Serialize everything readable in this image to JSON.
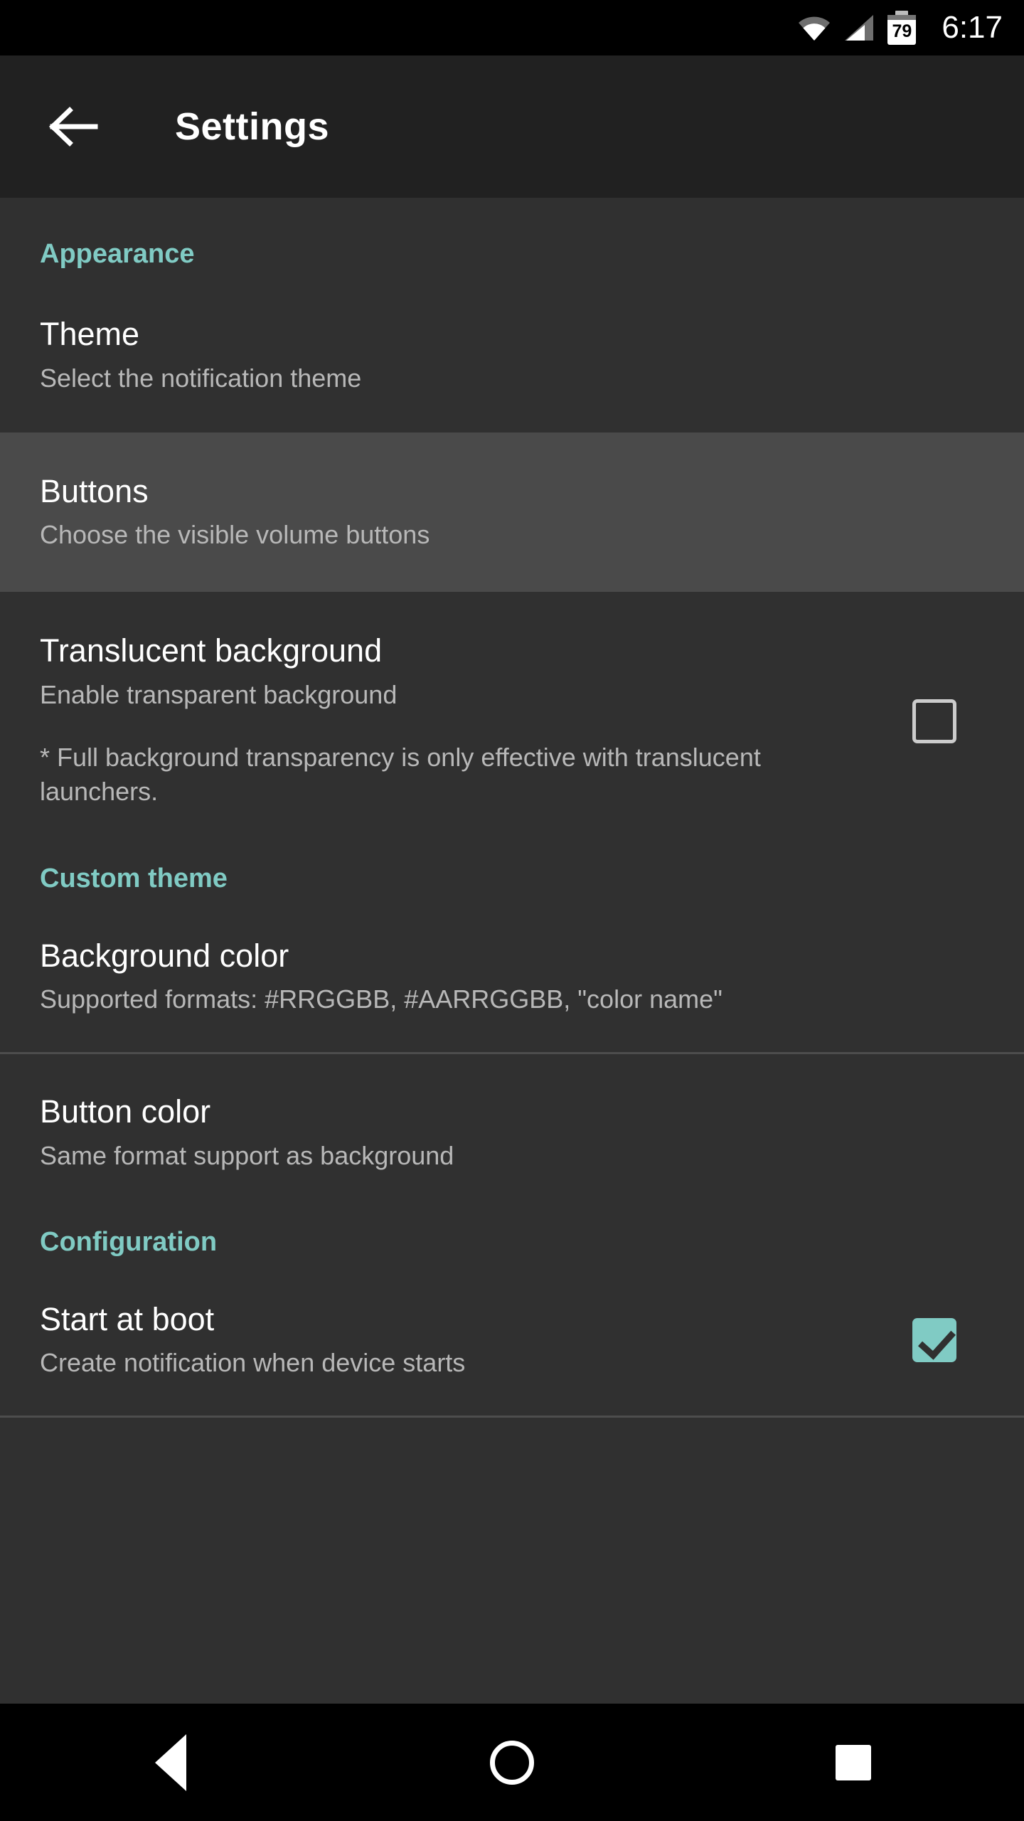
{
  "status_bar": {
    "wifi_icon": "wifi-icon",
    "signal_icon": "cell-signal-icon",
    "battery_icon": "battery-icon",
    "battery_level": "79",
    "time": "6:17"
  },
  "toolbar": {
    "back_icon": "arrow-back-icon",
    "title": "Settings"
  },
  "sections": [
    {
      "header": "Appearance",
      "items": [
        {
          "title": "Theme",
          "summary": "Select the notification theme"
        },
        {
          "title": "Buttons",
          "summary": "Choose the visible volume buttons"
        },
        {
          "title": "Translucent background",
          "summary": "Enable transparent background",
          "note": "* Full background transparency is only effective with translucent launchers.",
          "checked": "false"
        }
      ]
    },
    {
      "header": "Custom theme",
      "items": [
        {
          "title": "Background color",
          "summary": "Supported formats: #RRGGBB, #AARRGGBB, \"color name\""
        },
        {
          "title": "Button color",
          "summary": "Same format support as background"
        }
      ]
    },
    {
      "header": "Configuration",
      "items": [
        {
          "title": "Start at boot",
          "summary": "Create notification when device starts",
          "checked": "true"
        }
      ]
    }
  ],
  "nav_bar": {
    "back_label": "back-icon",
    "home_label": "home-icon",
    "recents_label": "recents-icon"
  },
  "colors": {
    "accent": "#80cbc4",
    "toolbar_bg": "#212121",
    "content_bg": "#303030",
    "highlight_bg": "#4a4a4a",
    "title_text": "#ffffff",
    "summary_text": "#b8b8b8",
    "divider": "#4d4d4d",
    "nav_bg": "#000000"
  }
}
